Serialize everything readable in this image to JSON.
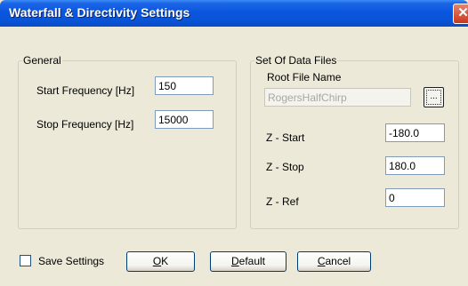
{
  "window": {
    "title": "Waterfall & Directivity Settings",
    "close_glyph": "✕"
  },
  "general": {
    "legend": "General",
    "start_label": "Start Frequency [Hz]",
    "start_value": "150",
    "stop_label": "Stop Frequency [Hz]",
    "stop_value": "15000"
  },
  "data_files": {
    "legend": "Set Of Data Files",
    "root_label": "Root File Name",
    "root_value": "RogersHalfChirp",
    "browse_label": "...",
    "zstart_label": "Z - Start",
    "zstart_value": "-180.0",
    "zstop_label": "Z - Stop",
    "zstop_value": "180.0",
    "zref_label": "Z - Ref",
    "zref_value": "0"
  },
  "footer": {
    "save_label": "Save Settings",
    "save_checked": false,
    "ok_key": "O",
    "ok_rest": "K",
    "default_key": "D",
    "default_rest": "efault",
    "cancel_key": "C",
    "cancel_rest": "ancel"
  }
}
